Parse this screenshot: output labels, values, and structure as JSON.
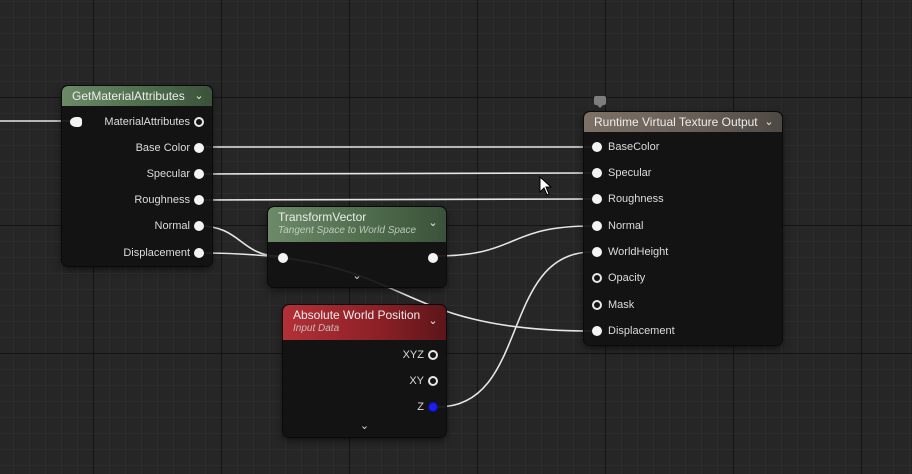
{
  "nodes": {
    "get_material_attributes": {
      "title": "GetMaterialAttributes",
      "input": "MaterialAttributes",
      "outputs": [
        "Base Color",
        "Specular",
        "Roughness",
        "Normal",
        "Displacement"
      ]
    },
    "transform_vector": {
      "title": "TransformVector",
      "subtitle": "Tangent Space to World Space"
    },
    "absolute_world_position": {
      "title": "Absolute World Position",
      "subtitle": "Input Data",
      "outputs": [
        "XYZ",
        "XY",
        "Z"
      ]
    },
    "rvt_output": {
      "title": "Runtime Virtual Texture Output",
      "inputs": [
        "BaseColor",
        "Specular",
        "Roughness",
        "Normal",
        "WorldHeight",
        "Opacity",
        "Mask",
        "Displacement"
      ]
    }
  },
  "icons": {
    "collapse": "chevron-down-icon",
    "expand": "chevron-down-icon",
    "comment": "comment-icon",
    "cursor": "mouse-cursor-icon"
  },
  "colors": {
    "pin_float": "#f4f4f4",
    "pin_z": "#1e1ee6",
    "wire": "#e6e6e6",
    "header_function": "#6c8a68",
    "header_constant": "#b33037",
    "header_output": "#7d7166"
  }
}
